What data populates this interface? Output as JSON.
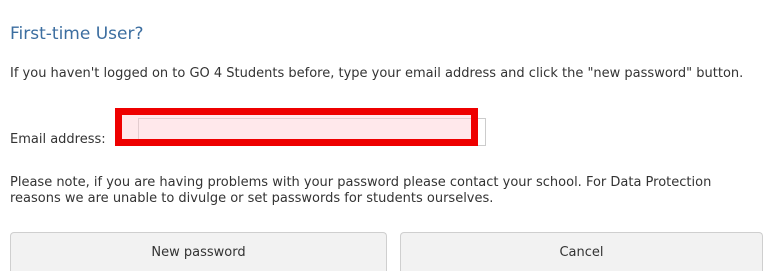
{
  "title": "First-time User?",
  "intro": "If you haven't logged on to GO 4 Students before, type your email address and click the \"new password\" button.",
  "email": {
    "label": "Email address:",
    "value": "",
    "placeholder": ""
  },
  "note": "Please note, if you are having problems with your password please contact your school. For Data Protection reasons we are unable to divulge or set passwords for students ourselves.",
  "buttons": {
    "new_password": "New password",
    "cancel": "Cancel"
  },
  "colors": {
    "title": "#3c6ea0",
    "highlight_border": "#ee0000"
  }
}
